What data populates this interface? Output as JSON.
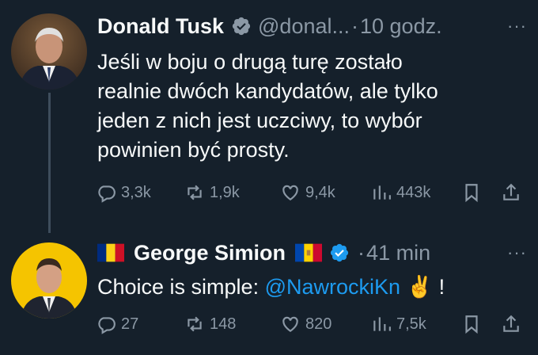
{
  "tweets": [
    {
      "author": "Donald Tusk",
      "handle": "@donal...",
      "dot": "·",
      "time": "10 godz.",
      "more": "···",
      "text_lines": [
        "Jeśli w boju o drugą turę zostało",
        "realnie dwóch kandydatów, ale tylko",
        "jeden z nich jest uczciwy, to wybór",
        "powinien być prosty."
      ],
      "stats": {
        "replies": "3,3k",
        "retweets": "1,9k",
        "likes": "9,4k",
        "views": "443k"
      }
    },
    {
      "author": "George Simion",
      "dot": "·",
      "time": "41 min",
      "more": "···",
      "text_prefix": "Choice is simple: ",
      "mention": "@NawrockiKn",
      "emoji": "✌",
      "text_suffix": " !",
      "stats": {
        "replies": "27",
        "retweets": "148",
        "likes": "820",
        "views": "7,5k"
      }
    }
  ],
  "colors": {
    "background": "#15202b",
    "text": "#e7e9ea",
    "muted": "#8b98a5",
    "accent": "#1d9bf0"
  },
  "icons": [
    "verified-badge-icon",
    "reply-icon",
    "retweet-icon",
    "like-icon",
    "views-icon",
    "bookmark-icon",
    "share-icon",
    "romania-flag-icon",
    "moldova-flag-icon"
  ]
}
